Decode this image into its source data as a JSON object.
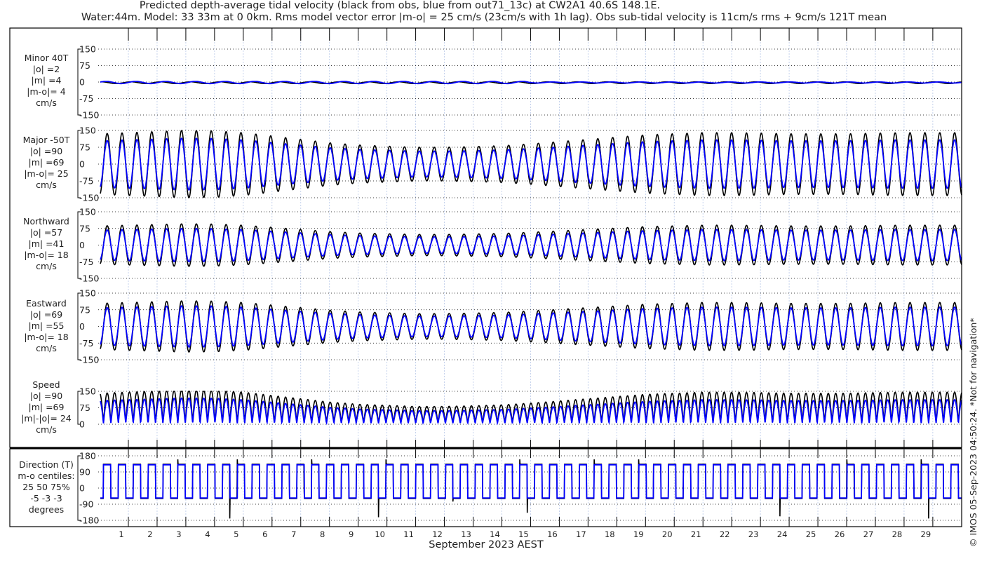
{
  "title_line1": "Predicted depth-average tidal velocity (black from obs, blue from out71_13c) at CW2A1 40.6S 148.1E.",
  "title_line2": "Water:44m. Model: 33 33m at 0 0km. Rms model vector error |m-o| = 25 cm/s (23cm/s with 1h lag). Obs sub-tidal velocity is 11cm/s rms + 9cm/s 121T mean",
  "credit": "© IMOS 05-Sep-2023 04:50:24. *Not for navigation*",
  "colors": {
    "obs": "#000000",
    "model": "#0000ff",
    "grid": "#000000",
    "daygrid": "#b8c8e8"
  },
  "chart_data": {
    "type": "line",
    "xlabel": "September 2023 AEST",
    "x_ticks": [
      "1",
      "2",
      "3",
      "4",
      "5",
      "6",
      "7",
      "8",
      "9",
      "10",
      "11",
      "12",
      "13",
      "14",
      "15",
      "16",
      "17",
      "18",
      "19",
      "20",
      "21",
      "22",
      "23",
      "24",
      "25",
      "26",
      "27",
      "28",
      "29"
    ],
    "x_range_days": [
      0.02,
      30.0
    ],
    "spring_neap_envelope_obs_cm_s": [
      135,
      140,
      145,
      150,
      148,
      140,
      125,
      110,
      95,
      85,
      80,
      75,
      75,
      78,
      82,
      90,
      100,
      110,
      120,
      130,
      135,
      140,
      140,
      138,
      135,
      135,
      135,
      138,
      140,
      140
    ],
    "series_legend": [
      {
        "name": "obs",
        "color": "black"
      },
      {
        "name": "model out71_13c",
        "color": "blue"
      }
    ],
    "panels": [
      {
        "id": "minor",
        "label": [
          "Minor 40T",
          "|o| =2",
          "|m| =4",
          "|m-o|= 4",
          "cm/s"
        ],
        "ylim": [
          -150,
          150
        ],
        "yticks": [
          "150",
          "75",
          "0",
          "-75",
          "-150"
        ],
        "obs_scale": 0.03,
        "model_scale": 0.05
      },
      {
        "id": "major",
        "label": [
          "Major -50T",
          "|o| =90",
          "|m| =69",
          "|m-o|= 25",
          "cm/s"
        ],
        "ylim": [
          -150,
          150
        ],
        "yticks": [
          "150",
          "75",
          "0",
          "-75",
          "-150"
        ],
        "obs_scale": 1.0,
        "model_scale": 0.77
      },
      {
        "id": "northward",
        "label": [
          "Northward",
          "|o| =57",
          "|m| =41",
          "|m-o|= 18",
          "cm/s"
        ],
        "ylim": [
          -150,
          150
        ],
        "yticks": [
          "150",
          "75",
          "0",
          "-75",
          "-150"
        ],
        "obs_scale": 0.64,
        "model_scale": 0.5
      },
      {
        "id": "eastward",
        "label": [
          "Eastward",
          "|o| =69",
          "|m| =55",
          "|m-o|= 18",
          "cm/s"
        ],
        "ylim": [
          -150,
          150
        ],
        "yticks": [
          "150",
          "75",
          "0",
          "-75",
          "-150"
        ],
        "obs_scale": 0.77,
        "model_scale": 0.62
      },
      {
        "id": "speed",
        "label": [
          "Speed",
          "|o| =90",
          "|m| =69",
          "|m|-|o|= 24",
          "cm/s"
        ],
        "ylim": [
          0,
          150
        ],
        "yticks": [
          "150",
          "75",
          "0"
        ],
        "obs_scale": 1.0,
        "model_scale": 0.77
      },
      {
        "id": "direction",
        "label": [
          "Direction (T)",
          "m-o centiles:",
          "25  50  75%",
          "-5 -3 -3",
          "degrees"
        ],
        "ylim": [
          -180,
          180
        ],
        "yticks": [
          "180",
          "90",
          "0",
          "-90",
          "-180"
        ],
        "flood_dir": 130,
        "ebb_dir": -55
      }
    ]
  }
}
